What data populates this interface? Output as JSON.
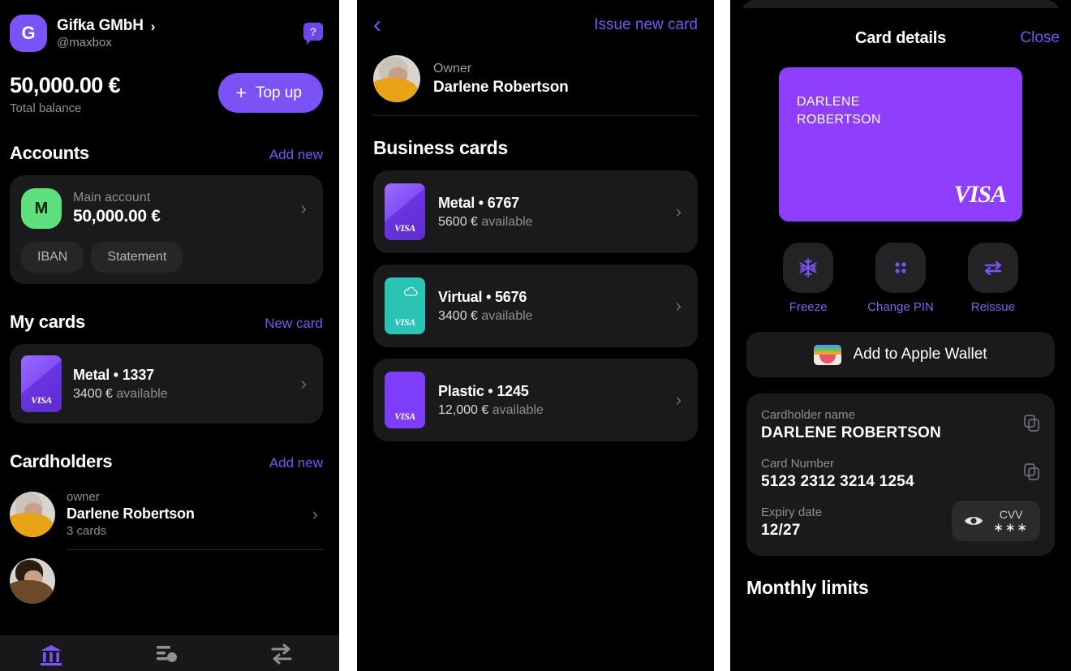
{
  "accent": "#7b52f5",
  "home": {
    "profile": {
      "avatar_letter": "G",
      "company": "Gifka GMbH",
      "handle": "@maxbox",
      "chevron": "›",
      "help_glyph": "?"
    },
    "balance": {
      "amount": "50,000.00 €",
      "label": "Total balance",
      "topup_label": "Top up",
      "plus_glyph": "+"
    },
    "accounts": {
      "title": "Accounts",
      "link": "Add new",
      "item": {
        "badge_letter": "M",
        "name": "Main account",
        "amount": "50,000.00 €",
        "chevron": "›",
        "actions": [
          "IBAN",
          "Statement"
        ]
      }
    },
    "my_cards": {
      "title": "My cards",
      "link": "New card",
      "items": [
        {
          "title": "Metal • 1337",
          "sub_amount": "3400 €",
          "sub_rest": " available",
          "brand": "VISA",
          "style": "purple-gradient",
          "chevron": "›"
        }
      ]
    },
    "cardholders": {
      "title": "Cardholders",
      "link": "Add new",
      "items": [
        {
          "role": "owner",
          "name": "Darlene Robertson",
          "cards": "3 cards",
          "chevron": "›"
        }
      ]
    },
    "tabbar": [
      {
        "icon": "bank-icon",
        "active": true
      },
      {
        "icon": "cards-icon",
        "active": false
      },
      {
        "icon": "transfer-icon",
        "active": false
      }
    ]
  },
  "cards_list": {
    "back_glyph": "‹",
    "issue_link": "Issue new card",
    "owner": {
      "role": "Owner",
      "name": "Darlene Robertson"
    },
    "section_title": "Business cards",
    "cards": [
      {
        "title": "Metal • 6767",
        "sub_amount": "5600 €",
        "sub_rest": " available",
        "brand": "VISA",
        "style": "purple-gradient",
        "chevron": "›"
      },
      {
        "title": "Virtual • 5676",
        "sub_amount": "3400 €",
        "sub_rest": " available",
        "brand": "VISA",
        "style": "teal-cloud",
        "chevron": "›"
      },
      {
        "title": "Plastic • 1245",
        "sub_amount": "12,000 €",
        "sub_rest": " available",
        "brand": "VISA",
        "style": "purple-flat",
        "chevron": "›"
      }
    ]
  },
  "card_details": {
    "title": "Card details",
    "close_label": "Close",
    "card": {
      "holder_line1": "DARLENE",
      "holder_line2": "ROBERTSON",
      "brand": "VISA",
      "color": "#8f3ffb"
    },
    "actions": [
      {
        "icon": "snowflake-icon",
        "label": "Freeze"
      },
      {
        "icon": "four-dots-icon",
        "label": "Change PIN"
      },
      {
        "icon": "swap-arrows-icon",
        "label": "Reissue"
      }
    ],
    "wallet_button": {
      "icon": "apple-wallet-icon",
      "label": "Add to Apple Wallet"
    },
    "fields": [
      {
        "label": "Cardholder name",
        "value": "DARLENE ROBERTSON",
        "copy": true
      },
      {
        "label": "Card Number",
        "value": "5123 2312 3214 1254",
        "copy": true
      },
      {
        "label": "Expiry date",
        "value": "12/27",
        "copy": false
      }
    ],
    "cvv": {
      "label": "CVV",
      "masked": "∗∗∗",
      "icon": "eye-icon"
    },
    "limits_title": "Monthly limits"
  }
}
